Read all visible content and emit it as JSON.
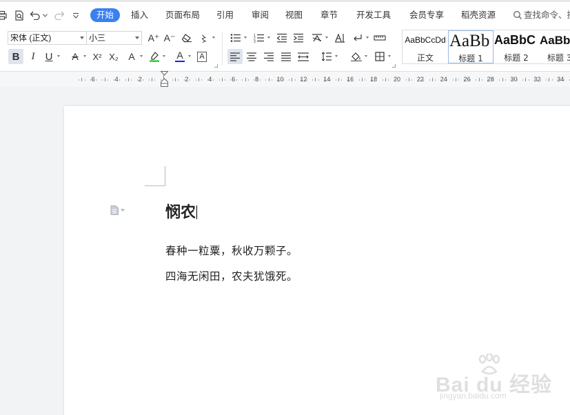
{
  "menu": {
    "tabs": [
      {
        "label": "开始",
        "active": true
      },
      {
        "label": "插入"
      },
      {
        "label": "页面布局"
      },
      {
        "label": "引用"
      },
      {
        "label": "审阅"
      },
      {
        "label": "视图"
      },
      {
        "label": "章节"
      },
      {
        "label": "开发工具"
      },
      {
        "label": "会员专享"
      },
      {
        "label": "稻壳资源"
      }
    ],
    "search": "查找命令、搜",
    "quick_icons": [
      "print-icon",
      "print-preview-icon",
      "undo-icon",
      "redo-icon",
      "customize-dropdown-icon"
    ]
  },
  "ribbon": {
    "font_name": "宋体 (正文)",
    "font_size": "小三",
    "buttons": {
      "grow_font": "A⁺",
      "shrink_font": "A⁻",
      "bold": "B",
      "italic": "I",
      "underline": "U",
      "superscript": "X²",
      "subscript": "X₂",
      "font_color": "A",
      "char_border": "A",
      "strikethrough": "A"
    },
    "colors": {
      "highlight": "#18c918",
      "font_color": "#1a1aff",
      "accent": "#3a80f0"
    },
    "styles": [
      {
        "preview": "AaBbCcDd",
        "name": "正文"
      },
      {
        "preview": "AaBb",
        "name": "标题 1"
      },
      {
        "preview": "AaBbC",
        "name": "标题 2"
      },
      {
        "preview": "AaBb",
        "name": "标题 3"
      }
    ]
  },
  "ruler": {
    "numbers": [
      "6",
      "4",
      "2",
      "2",
      "4",
      "6",
      "8",
      "10",
      "12",
      "14",
      "16",
      "18",
      "20",
      "22",
      "24",
      "26",
      "28",
      "30",
      "32",
      "34"
    ]
  },
  "document": {
    "title": "悯农",
    "lines": [
      "春种一粒粟，秋收万颗子。",
      "四海无闲田，农夫犹饿死。"
    ]
  },
  "watermark": {
    "main": "Bai du 经验",
    "sub": "jingyan.baidu.com"
  }
}
